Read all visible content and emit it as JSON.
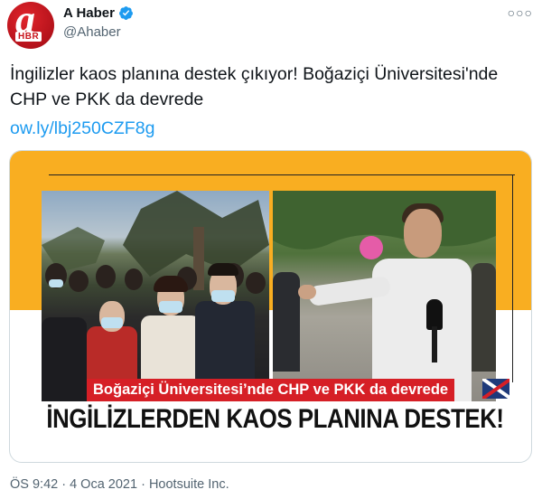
{
  "author": {
    "display_name": "A Haber",
    "handle": "@Ahaber",
    "avatar_label": "HBR",
    "avatar_letter": "a",
    "verified_icon": "verified-badge-icon"
  },
  "menu": {
    "more_label": "○○○",
    "more_icon": "more-options-icon"
  },
  "tweet": {
    "text": "İngilizler kaos planına destek çıkıyor! Boğaziçi Üniversitesi'nde CHP ve PKK da devrede",
    "link": "ow.ly/lbj250CZF8g"
  },
  "media": {
    "headline_bar": "Boğaziçi Üniversitesi’nde CHP ve PKK da devrede",
    "big_headline": "İNGİLİZLERDEN KAOS PLANINA DESTEK!",
    "accent_color": "#f9ae21",
    "bar_color": "#d61f26"
  },
  "meta": {
    "timestamp": "ÖS 9:42 · 4 Oca 2021 · Hootsuite Inc."
  }
}
